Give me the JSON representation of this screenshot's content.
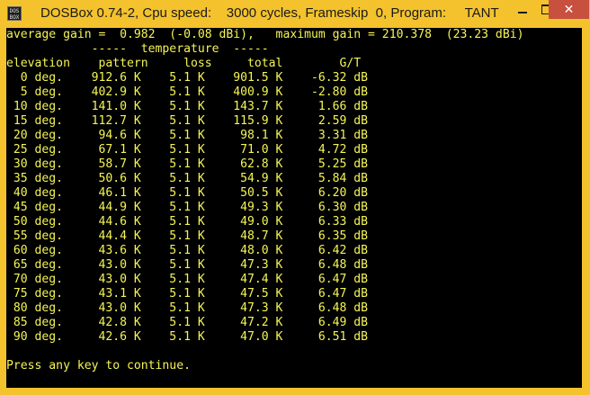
{
  "window": {
    "title": "DOSBox 0.74-2, Cpu speed:    3000 cycles, Frameskip  0, Program:     TANT",
    "icon_text": "DOS\nBOX",
    "icons": {
      "app": "dosbox-app-icon",
      "minimize": "minimize-icon",
      "maximize": "maximize-icon",
      "close": "close-icon"
    },
    "close_symbol": "✕"
  },
  "colors": {
    "text": "#f5f556",
    "highlight": "#ff5a5a",
    "background": "#000000",
    "titlebar": "#f4c22d",
    "close_button": "#c7503f"
  },
  "console": {
    "summary": "average gain =  0.982  (-0.08 dBi),   maximum gain = 210.378  (23.23 dBi)",
    "group_header": "            -----  temperature  -----",
    "column_header": "elevation    pattern     loss     total        G/T",
    "rows": [
      "  0 deg.    912.6 K    5.1 K    901.5 K    -6.32 dB",
      "  5 deg.    402.9 K    5.1 K    400.9 K    -2.80 dB",
      " 10 deg.    141.0 K    5.1 K    143.7 K     1.66 dB",
      " 15 deg.    112.7 K    5.1 K    115.9 K     2.59 dB",
      " 20 deg.     94.6 K    5.1 K     98.1 K     3.31 dB",
      " 25 deg.     67.1 K    5.1 K     71.0 K     4.72 dB",
      " 30 deg.     58.7 K    5.1 K     62.8 K     5.25 dB",
      " 35 deg.     50.6 K    5.1 K     54.9 K     5.84 dB",
      " 40 deg.     46.1 K    5.1 K     50.5 K     6.20 dB",
      " 45 deg.     44.9 K    5.1 K     49.3 K     6.30 dB",
      " 50 deg.     44.6 K    5.1 K     49.0 K     6.33 dB",
      " 55 deg.     44.4 K    5.1 K     48.7 K     6.35 dB",
      " 60 deg.     43.6 K    5.1 K     48.0 K     6.42 dB",
      " 65 deg.     43.0 K    5.1 K     47.3 K     6.48 dB",
      " 70 deg.     43.0 K    5.1 K     47.4 K     6.47 dB",
      " 75 deg.     43.1 K    5.1 K     47.5 K     6.47 dB",
      " 80 deg.     43.0 K    5.1 K     47.3 K     6.48 dB",
      " 85 deg.     42.8 K    5.1 K     47.2 K     6.49 dB",
      " 90 deg.     42.6 K    5.1 K     47.0 K     6.51 dB"
    ],
    "highlighted_row_index": 6,
    "prompt": "Press any key to continue."
  }
}
